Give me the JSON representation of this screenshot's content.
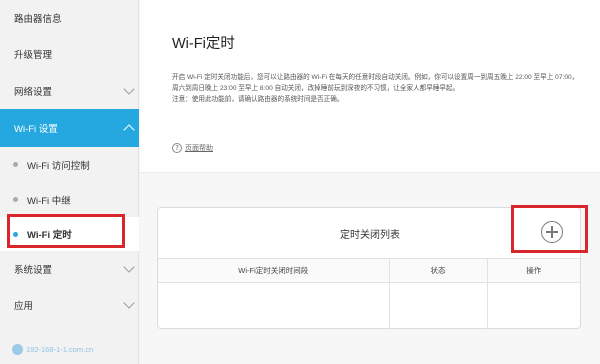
{
  "sidebar": {
    "items": [
      {
        "label": "路由器信息"
      },
      {
        "label": "升级管理"
      },
      {
        "label": "网络设置"
      },
      {
        "label": "Wi-Fi 设置"
      },
      {
        "label": "Wi-Fi 访问控制"
      },
      {
        "label": "Wi-Fi 中继"
      },
      {
        "label": "Wi-Fi 定时"
      },
      {
        "label": "系统设置"
      },
      {
        "label": "应用"
      }
    ]
  },
  "main": {
    "title": "Wi-Fi定时",
    "description": "开启 Wi-Fi 定时关闭功能后，您可以让路由器的 Wi-Fi 在每天的任意时段自动关闭。例如，你可以设置周一到周五晚上 22:00 至早上 07:00，周六到周日晚上 23:00 至早上 8:00 自动关闭，改掉睡前玩到深夜的不习惯，让全家人都早睡早起。",
    "note": "注意：使用此功能前，请确认路由器的系统时间是否正确。",
    "help_label": "页面帮助",
    "help_icon_glyph": "?"
  },
  "panel": {
    "title": "定时关闭列表",
    "columns": [
      "Wi-Fi定时关闭时间段",
      "状态",
      "操作"
    ]
  },
  "watermark": "192-168-1-1.com.cn",
  "colors": {
    "accent": "#25a7e0",
    "highlight": "#d9262c"
  }
}
